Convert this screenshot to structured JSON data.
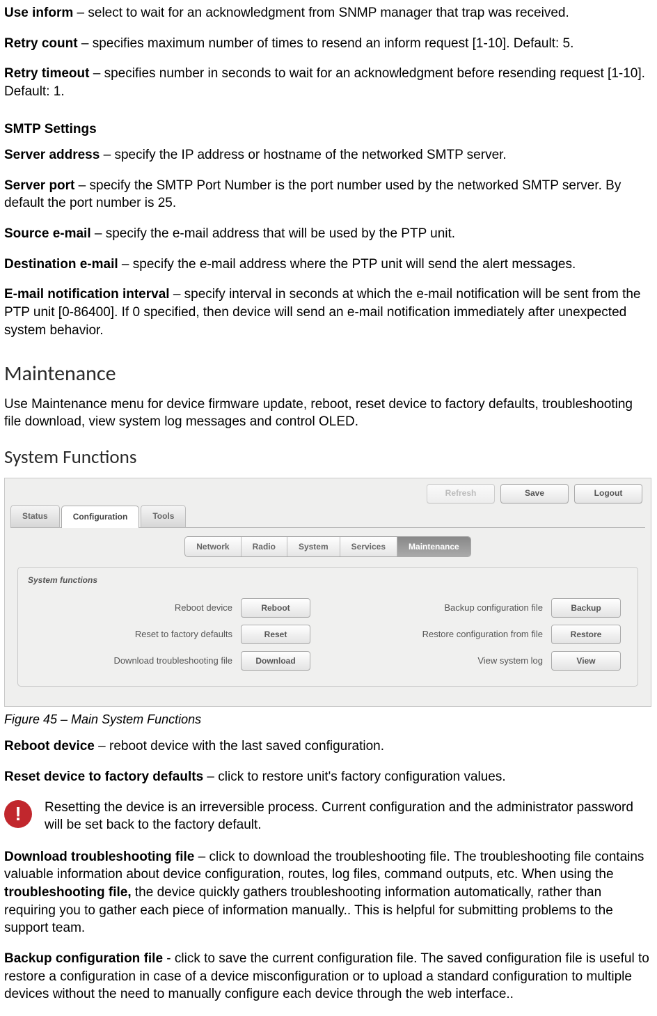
{
  "snmp": {
    "use_inform_term": "Use inform",
    "use_inform_desc": " – select to wait for an acknowledgment from SNMP manager that trap was received.",
    "retry_count_term": "Retry count",
    "retry_count_desc": " – specifies maximum number of times to resend an inform request [1-10]. Default: 5.",
    "retry_timeout_term": "Retry timeout",
    "retry_timeout_desc": " – specifies number in seconds to wait for an acknowledgment before resending request [1-10]. Default: 1."
  },
  "smtp": {
    "heading": "SMTP Settings",
    "server_address_term": "Server address",
    "server_address_desc": " – specify the IP address or hostname of the networked SMTP server.",
    "server_port_term": "Server port",
    "server_port_desc": " – specify the SMTP Port Number is the port number used by the networked SMTP server. By default the port number is 25.",
    "source_email_term": "Source e-mail",
    "source_email_desc": " – specify the e-mail address that will be used by the PTP unit.",
    "dest_email_term": "Destination e-mail",
    "dest_email_desc": " – specify the e-mail address where the PTP unit will send the alert messages.",
    "interval_term": "E-mail notification interval",
    "interval_desc": " – specify interval in seconds at which the e-mail notification will be sent from the PTP unit [0-86400]. If 0 specified, then device will send an e-mail notification immediately after unexpected system behavior."
  },
  "maintenance": {
    "heading": "Maintenance",
    "intro": "Use Maintenance menu for device firmware update, reboot, reset device to factory defaults, troubleshooting file download, view system log messages and control OLED."
  },
  "sysfunc": {
    "heading": "System Functions",
    "caption": "Figure 45 – Main System Functions"
  },
  "ui": {
    "topbar": {
      "refresh": "Refresh",
      "save": "Save",
      "logout": "Logout"
    },
    "tabs": {
      "status": "Status",
      "configuration": "Configuration",
      "tools": "Tools"
    },
    "subtabs": {
      "network": "Network",
      "radio": "Radio",
      "system": "System",
      "services": "Services",
      "maintenance": "Maintenance"
    },
    "panel": {
      "title": "System functions",
      "reboot_label": "Reboot device",
      "reboot_btn": "Reboot",
      "reset_label": "Reset to factory defaults",
      "reset_btn": "Reset",
      "download_label": "Download troubleshooting file",
      "download_btn": "Download",
      "backup_label": "Backup configuration file",
      "backup_btn": "Backup",
      "restore_label": "Restore configuration from file",
      "restore_btn": "Restore",
      "view_label": "View system log",
      "view_btn": "View"
    }
  },
  "desc": {
    "reboot_term": "Reboot device",
    "reboot_desc": " – reboot device with the last saved configuration.",
    "reset_term": "Reset device to factory defaults",
    "reset_desc": " – click to restore unit's factory configuration values.",
    "warning_text": "Resetting the device is an irreversible process. Current configuration and the administrator password will be set back to the factory default.",
    "download_term": "Download troubleshooting file",
    "download_desc_1": " – click to download the troubleshooting file. The troubleshooting file contains valuable information about device configuration, routes, log files, command outputs, etc. When using the ",
    "download_bold": "troubleshooting file,",
    "download_desc_2": " the device quickly gathers troubleshooting information automatically, rather than requiring you to gather each piece of information manually.. This is helpful for submitting problems to the support team.",
    "backup_term": "Backup configuration file",
    "backup_desc": " - click to save the current configuration file. The saved configuration file is useful to restore a configuration in case of a device misconfiguration or to upload a standard configuration to multiple devices without the need to manually configure each device through the web interface.."
  }
}
